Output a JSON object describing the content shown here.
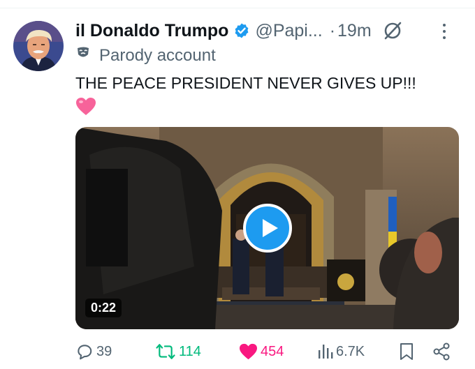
{
  "tweet": {
    "author_name": "il Donaldo Trumpo",
    "handle": "@Papi...",
    "separator": "·",
    "time": "19m",
    "label": "Parody account",
    "text": "THE PEACE PRESIDENT NEVER GIVES UP!!!",
    "emoji": "pink-heart",
    "verified": true
  },
  "media": {
    "type": "video",
    "duration": "0:22"
  },
  "actions": {
    "replies": "39",
    "reposts": "114",
    "likes": "454",
    "views": "6.7K",
    "liked": true
  },
  "colors": {
    "verified": "#1d9bf0",
    "repost": "#00ba7c",
    "like": "#f91880",
    "muted": "#536471",
    "text": "#0f1419"
  },
  "icons": {
    "verified": "verified-badge-icon",
    "grok": "grok-icon",
    "more": "more-icon",
    "parody": "theater-mask-icon",
    "reply": "reply-icon",
    "repost": "repost-icon",
    "like": "heart-icon",
    "views": "views-icon",
    "bookmark": "bookmark-icon",
    "share": "share-icon",
    "play": "play-icon"
  }
}
